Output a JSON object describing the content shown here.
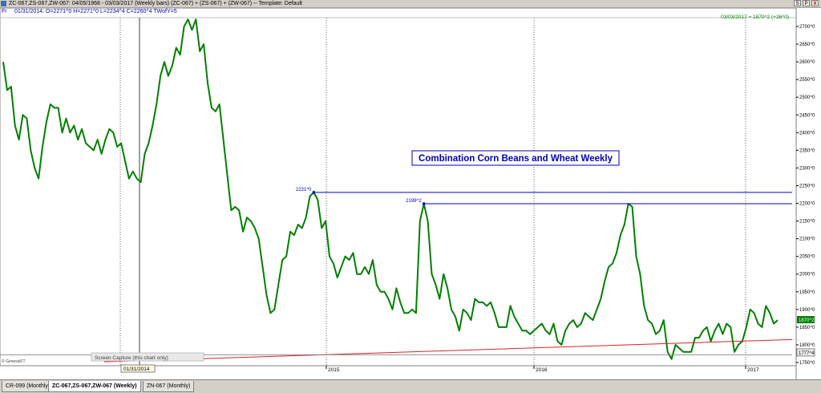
{
  "window": {
    "title": "ZC-067,ZS-067,ZW-067:  04/05/1968 - 03/03/2017  (Weekly bars)  (ZC-067) + (ZS-067) + (ZW-067)  --  Template: Default",
    "buttons": [
      "S",
      "P",
      "X"
    ]
  },
  "header": {
    "fr_label": "Fr",
    "bar_info": "01/31/2014:  O=2271^0  H=2271^0  L=2234^4  C=2260^4  TWofY=5",
    "last_info": "03/03/2017 = 1870^2 (+26^0)"
  },
  "chart_data": {
    "type": "line",
    "title": "Combination Corn Beans and Wheat Weekly",
    "x_ticks": [
      "2015",
      "2016",
      "2017"
    ],
    "y_ticks": [
      "2700^0",
      "2650^0",
      "2600^0",
      "2550^0",
      "2500^0",
      "2450^0",
      "2400^0",
      "2350^0",
      "2300^0",
      "2250^0",
      "2200^0",
      "2150^0",
      "2100^0",
      "2050^0",
      "2000^0",
      "1950^0",
      "1900^0",
      "1850^0",
      "1800^0",
      "1750^0"
    ],
    "ylim": [
      1740,
      2720
    ],
    "colors": {
      "series": "#008000",
      "hlines": "#0000c0",
      "trend": "#e02020",
      "title": "#0000c0"
    },
    "series": [
      {
        "values": [
          2600,
          2520,
          2530,
          2420,
          2380,
          2450,
          2440,
          2350,
          2300,
          2270,
          2360,
          2430,
          2480,
          2470,
          2470,
          2400,
          2440,
          2400,
          2420,
          2380,
          2410,
          2370,
          2360,
          2350,
          2380,
          2340,
          2380,
          2410,
          2400,
          2360,
          2370,
          2320,
          2270,
          2290,
          2270,
          2260,
          2340,
          2370,
          2420,
          2480,
          2560,
          2600,
          2560,
          2590,
          2640,
          2620,
          2700,
          2720,
          2690,
          2720,
          2630,
          2650,
          2540,
          2470,
          2460,
          2480,
          2380,
          2280,
          2180,
          2190,
          2180,
          2120,
          2160,
          2150,
          2130,
          2100,
          2020,
          1940,
          1890,
          1900,
          1970,
          2040,
          2050,
          2120,
          2110,
          2140,
          2130,
          2160,
          2220,
          2231,
          2210,
          2130,
          2150,
          2050,
          2030,
          1990,
          2020,
          2050,
          2040,
          2060,
          2000,
          2000,
          2020,
          2000,
          2040,
          1970,
          1950,
          1950,
          1930,
          1900,
          1960,
          1920,
          1890,
          1890,
          1900,
          1890,
          2150,
          2199,
          2150,
          2000,
          1970,
          1930,
          2000,
          1960,
          1900,
          1880,
          1840,
          1900,
          1890,
          1870,
          1930,
          1920,
          1920,
          1910,
          1920,
          1890,
          1850,
          1850,
          1850,
          1910,
          1880,
          1860,
          1840,
          1840,
          1830,
          1840,
          1850,
          1860,
          1840,
          1830,
          1860,
          1810,
          1800,
          1840,
          1860,
          1870,
          1850,
          1860,
          1890,
          1880,
          1870,
          1900,
          1930,
          1980,
          2020,
          2030,
          2060,
          2110,
          2140,
          2199,
          2190,
          2050,
          2000,
          1910,
          1870,
          1860,
          1830,
          1840,
          1870,
          1780,
          1760,
          1800,
          1790,
          1780,
          1780,
          1780,
          1820,
          1820,
          1840,
          1850,
          1810,
          1840,
          1860,
          1830,
          1860,
          1850,
          1780,
          1800,
          1810,
          1850,
          1900,
          1890,
          1860,
          1850,
          1910,
          1890,
          1860,
          1870
        ]
      }
    ],
    "levels": [
      {
        "label": "2231^0",
        "value": 2231
      },
      {
        "label": "2199^2",
        "value": 2199
      }
    ],
    "last_value_label": "1870^2",
    "low_value_label": "1777^4",
    "cursor_date": "01/31/2014",
    "copyright": "© GenesisFT"
  },
  "tooltip": {
    "text": "Screen Capture (this chart only)"
  },
  "tabs": [
    "CR-099 (Monthly)",
    "ZC-067,ZS-067,ZW-067 (Weekly)",
    "ZN-067 (Monthly)"
  ]
}
